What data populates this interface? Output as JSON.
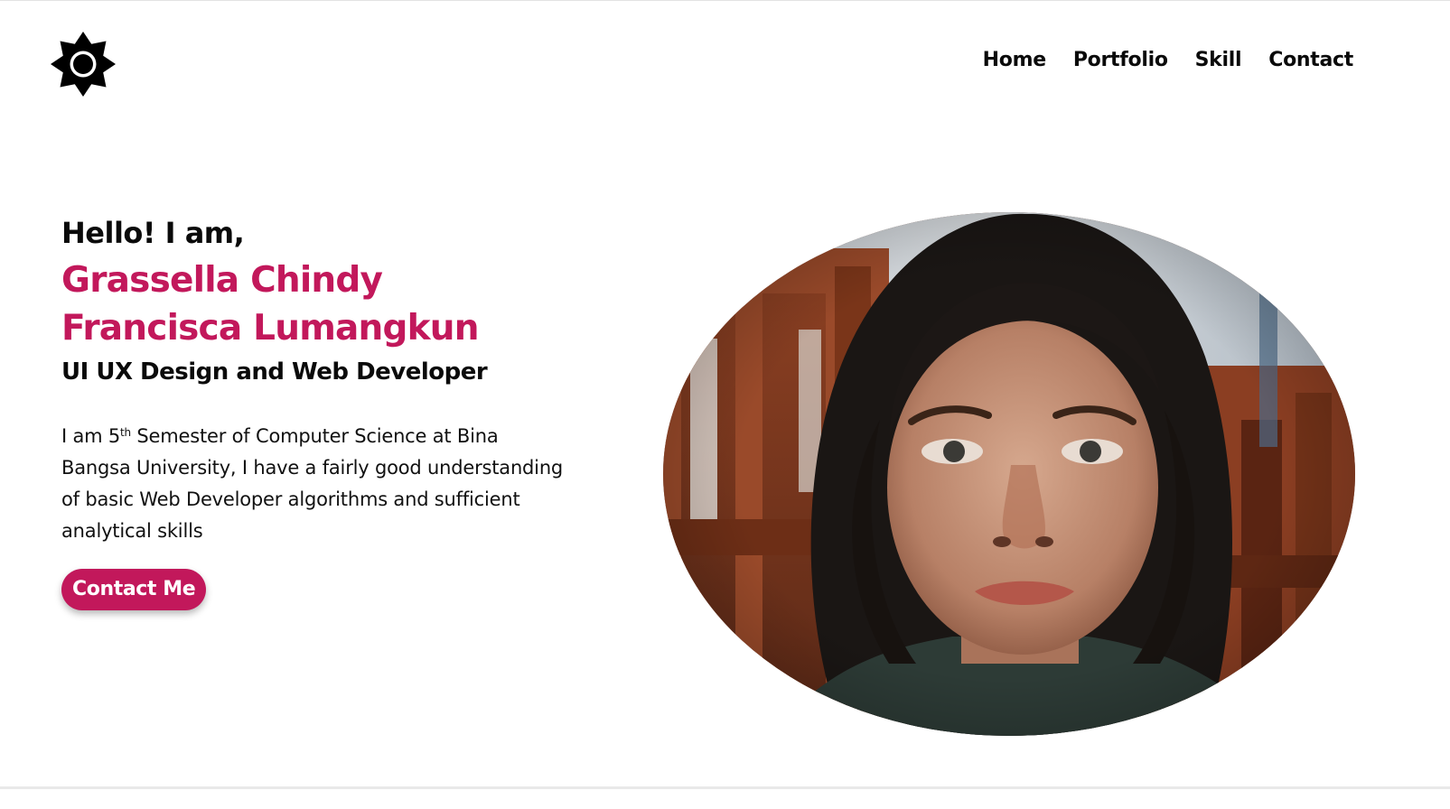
{
  "header": {
    "logo_icon": "sun-gear-icon",
    "nav": [
      {
        "label": "Home"
      },
      {
        "label": "Portfolio"
      },
      {
        "label": "Skill"
      },
      {
        "label": "Contact"
      }
    ]
  },
  "hero": {
    "greeting": "Hello! I am,",
    "name_line1": "Grassella Chindy",
    "name_line2": "Francisca Lumangkun",
    "role": "UI UX Design and Web Developer",
    "bio_part1": "I am 5",
    "bio_sup": "th",
    "bio_part2": " Semester of Computer Science at Bina Bangsa University, I have a fairly good understanding of basic Web Developer algorithms and sufficient analytical skills",
    "cta_label": "Contact Me",
    "photo_icon": "profile-photo"
  },
  "colors": {
    "accent": "#c2185b",
    "text": "#0a0a0a",
    "background": "#ffffff"
  }
}
